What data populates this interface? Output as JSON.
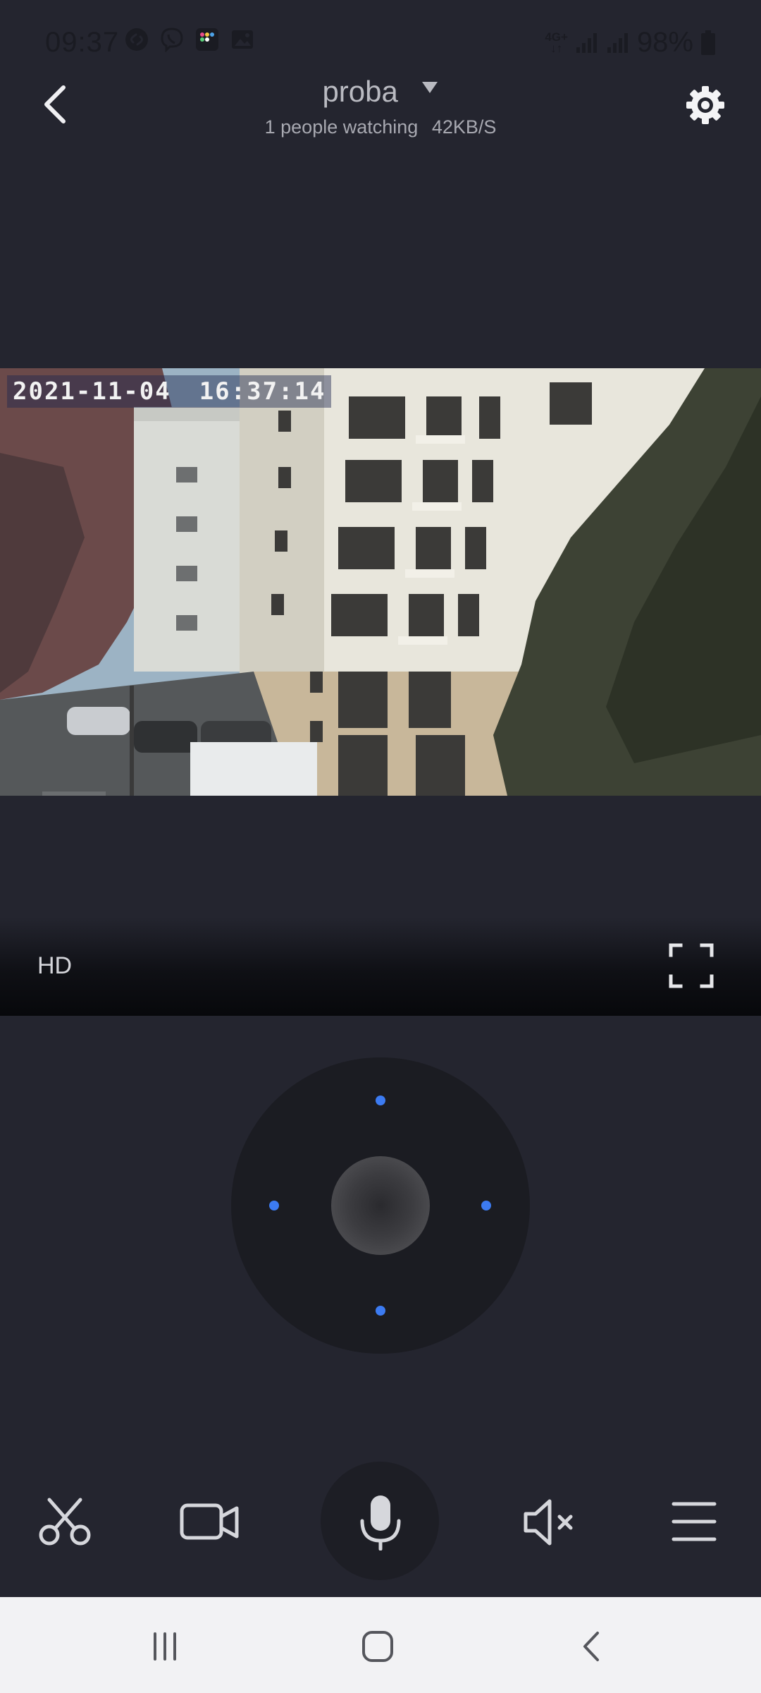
{
  "status_bar": {
    "time": "09:37",
    "network_label": "4G+",
    "battery_text": "98%",
    "left_icons": [
      "shazam-icon",
      "viber-icon",
      "app-grid-icon",
      "gallery-icon"
    ]
  },
  "header": {
    "camera_name": "proba",
    "viewers": "1 people watching",
    "bitrate": "42KB/S"
  },
  "video": {
    "osd_date": "2021-11-04",
    "osd_time": "16:37:14"
  },
  "controls": {
    "quality_label": "HD"
  },
  "toolbar": {
    "items": [
      "screenshot-scissors-icon",
      "record-video-icon",
      "microphone-icon",
      "speaker-muted-icon",
      "menu-icon"
    ]
  },
  "colors": {
    "background": "#24252f",
    "accent_blue": "#3c7bf2",
    "icon": "#d6d7dc"
  }
}
